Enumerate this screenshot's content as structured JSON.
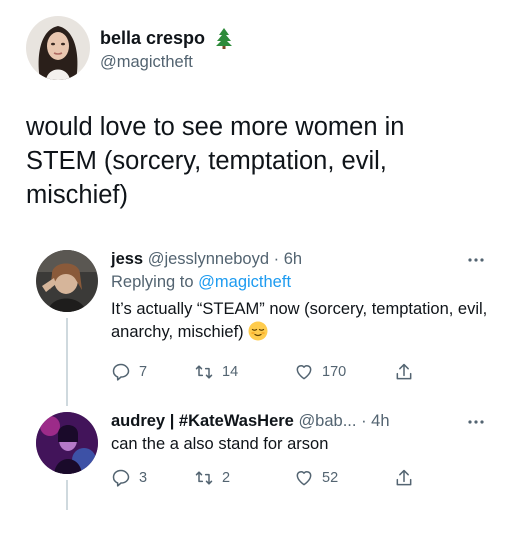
{
  "main_tweet": {
    "author_name": "bella crespo",
    "author_handle": "@magictheft",
    "name_emoji_icon": "evergreen-tree-icon",
    "text": "would love to see more women in\nSTEM (sorcery, temptation, evil,\nmischief)"
  },
  "replies": [
    {
      "author_name": "jess",
      "author_handle": "@jesslynneboyd",
      "separator": "·",
      "time": "6h",
      "replying_prefix": "Replying to",
      "replying_to": "@magictheft",
      "text": "It’s actually “STEAM” now (sorcery, temptation, evil, anarchy, mischief)",
      "emoji_icon": "relieved-face-icon",
      "reply_count": "7",
      "retweet_count": "14",
      "like_count": "170"
    },
    {
      "author_name": "audrey | #KateWasHere",
      "author_handle": "@bab...",
      "separator": "·",
      "time": "4h",
      "text": "can the a also stand for arson",
      "reply_count": "3",
      "retweet_count": "2",
      "like_count": "52"
    }
  ],
  "colors": {
    "text": "#0f1419",
    "secondary": "#536471",
    "link": "#1d9bf0",
    "thread_line": "#cfd9de"
  }
}
